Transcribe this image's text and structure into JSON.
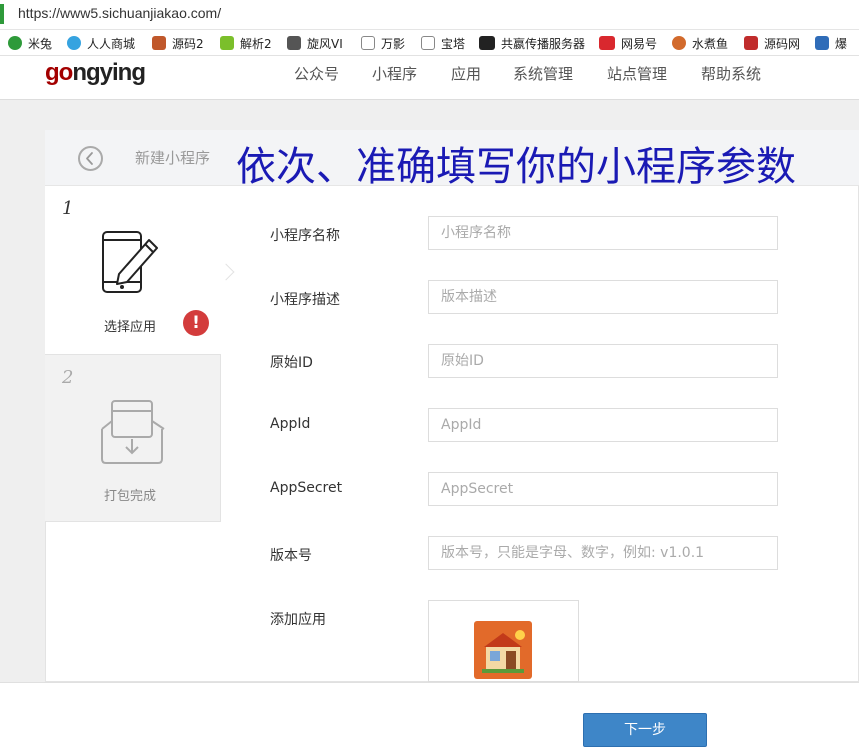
{
  "browser": {
    "url": "https://www5.sichuanjiakao.com/",
    "bookmarks": [
      {
        "label": "米兔",
        "icon": "mitu-icon",
        "color": "#2e9a3a"
      },
      {
        "label": "人人商城",
        "icon": "cloud-icon",
        "color": "#36a3e0"
      },
      {
        "label": "源码2",
        "icon": "source-icon",
        "color": "#c0582b"
      },
      {
        "label": "解析2",
        "icon": "parse-icon",
        "color": "#7bbf2b"
      },
      {
        "label": "旋风VI",
        "icon": "xuanfeng-icon",
        "color": "#555555"
      },
      {
        "label": "万影",
        "icon": "page-icon",
        "color": "#888888"
      },
      {
        "label": "宝塔",
        "icon": "page-icon",
        "color": "#888888"
      },
      {
        "label": "共嬴传播服务器",
        "icon": "bt-icon",
        "color": "#222222"
      },
      {
        "label": "网易号",
        "icon": "netease-icon",
        "color": "#d9282e"
      },
      {
        "label": "水煮鱼",
        "icon": "fish-icon",
        "color": "#d26a2c"
      },
      {
        "label": "源码网",
        "icon": "source-net-icon",
        "color": "#c02c2c"
      },
      {
        "label": "爆",
        "icon": "m-icon",
        "color": "#2f6cb8"
      }
    ]
  },
  "header": {
    "logo_prefix": "go",
    "logo_rest": "ngying",
    "nav": [
      "公众号",
      "小程序",
      "应用",
      "系统管理",
      "站点管理",
      "帮助系统"
    ]
  },
  "panel": {
    "title": "新建小程序",
    "overlay_title": "依次、准确填写你的小程序参数"
  },
  "steps": [
    {
      "number": "1",
      "label": "选择应用",
      "warning": "!"
    },
    {
      "number": "2",
      "label": "打包完成"
    }
  ],
  "form": {
    "fields": [
      {
        "label": "小程序名称",
        "placeholder": "小程序名称"
      },
      {
        "label": "小程序描述",
        "placeholder": "版本描述"
      },
      {
        "label": "原始ID",
        "placeholder": "原始ID"
      },
      {
        "label": "AppId",
        "placeholder": "AppId"
      },
      {
        "label": "AppSecret",
        "placeholder": "AppSecret"
      },
      {
        "label": "版本号",
        "placeholder": "版本号，只能是字母、数字，例如: v1.0.1"
      }
    ],
    "add_app_label": "添加应用"
  },
  "footer": {
    "next_label": "下一步"
  },
  "colors": {
    "primary": "#3e86c8",
    "warning": "#d33c3c",
    "overlay_text": "#1a1ab4",
    "logo": "#a30000"
  }
}
